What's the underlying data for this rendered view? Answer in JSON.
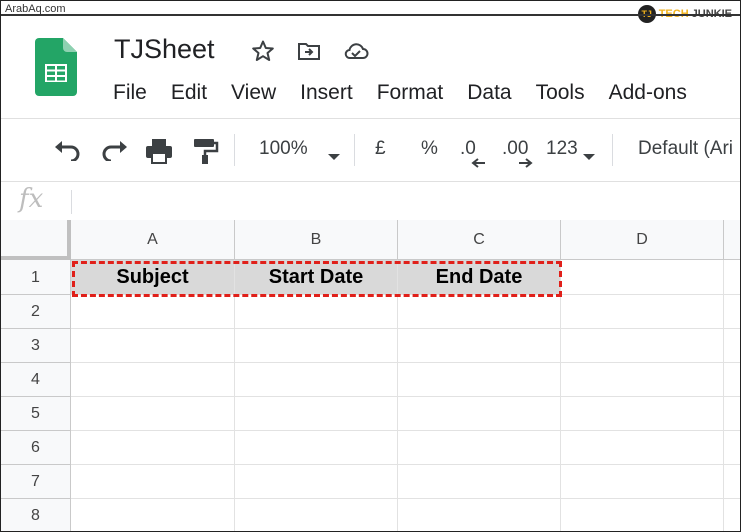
{
  "watermarks": {
    "left": "ArabAq.com",
    "right_tech": "TECH",
    "right_junkie": "JUNKIE",
    "right_logo": "TJ"
  },
  "app": {
    "title": "TJSheet",
    "logo_icon": "google-sheets-icon",
    "title_icons": [
      "star-icon",
      "move-to-folder-icon",
      "cloud-saved-icon"
    ]
  },
  "menu": [
    "File",
    "Edit",
    "View",
    "Insert",
    "Format",
    "Data",
    "Tools",
    "Add-ons"
  ],
  "toolbar": {
    "zoom": "100%",
    "currency": "£",
    "percent": "%",
    "decrease_decimal": ".0",
    "increase_decimal": ".00",
    "number_format": "123",
    "font": "Default (Ari"
  },
  "formula_bar": {
    "fx": "fx",
    "value": ""
  },
  "columns": [
    "A",
    "B",
    "C",
    "D"
  ],
  "rows": [
    "1",
    "2",
    "3",
    "4",
    "5",
    "6",
    "7",
    "8"
  ],
  "cells": {
    "A1": "Subject",
    "B1": "Start Date",
    "C1": "End Date"
  },
  "colors": {
    "header_fill": "#d9d9d9",
    "highlight_border": "#e0201a",
    "sheets_green": "#23a566"
  }
}
